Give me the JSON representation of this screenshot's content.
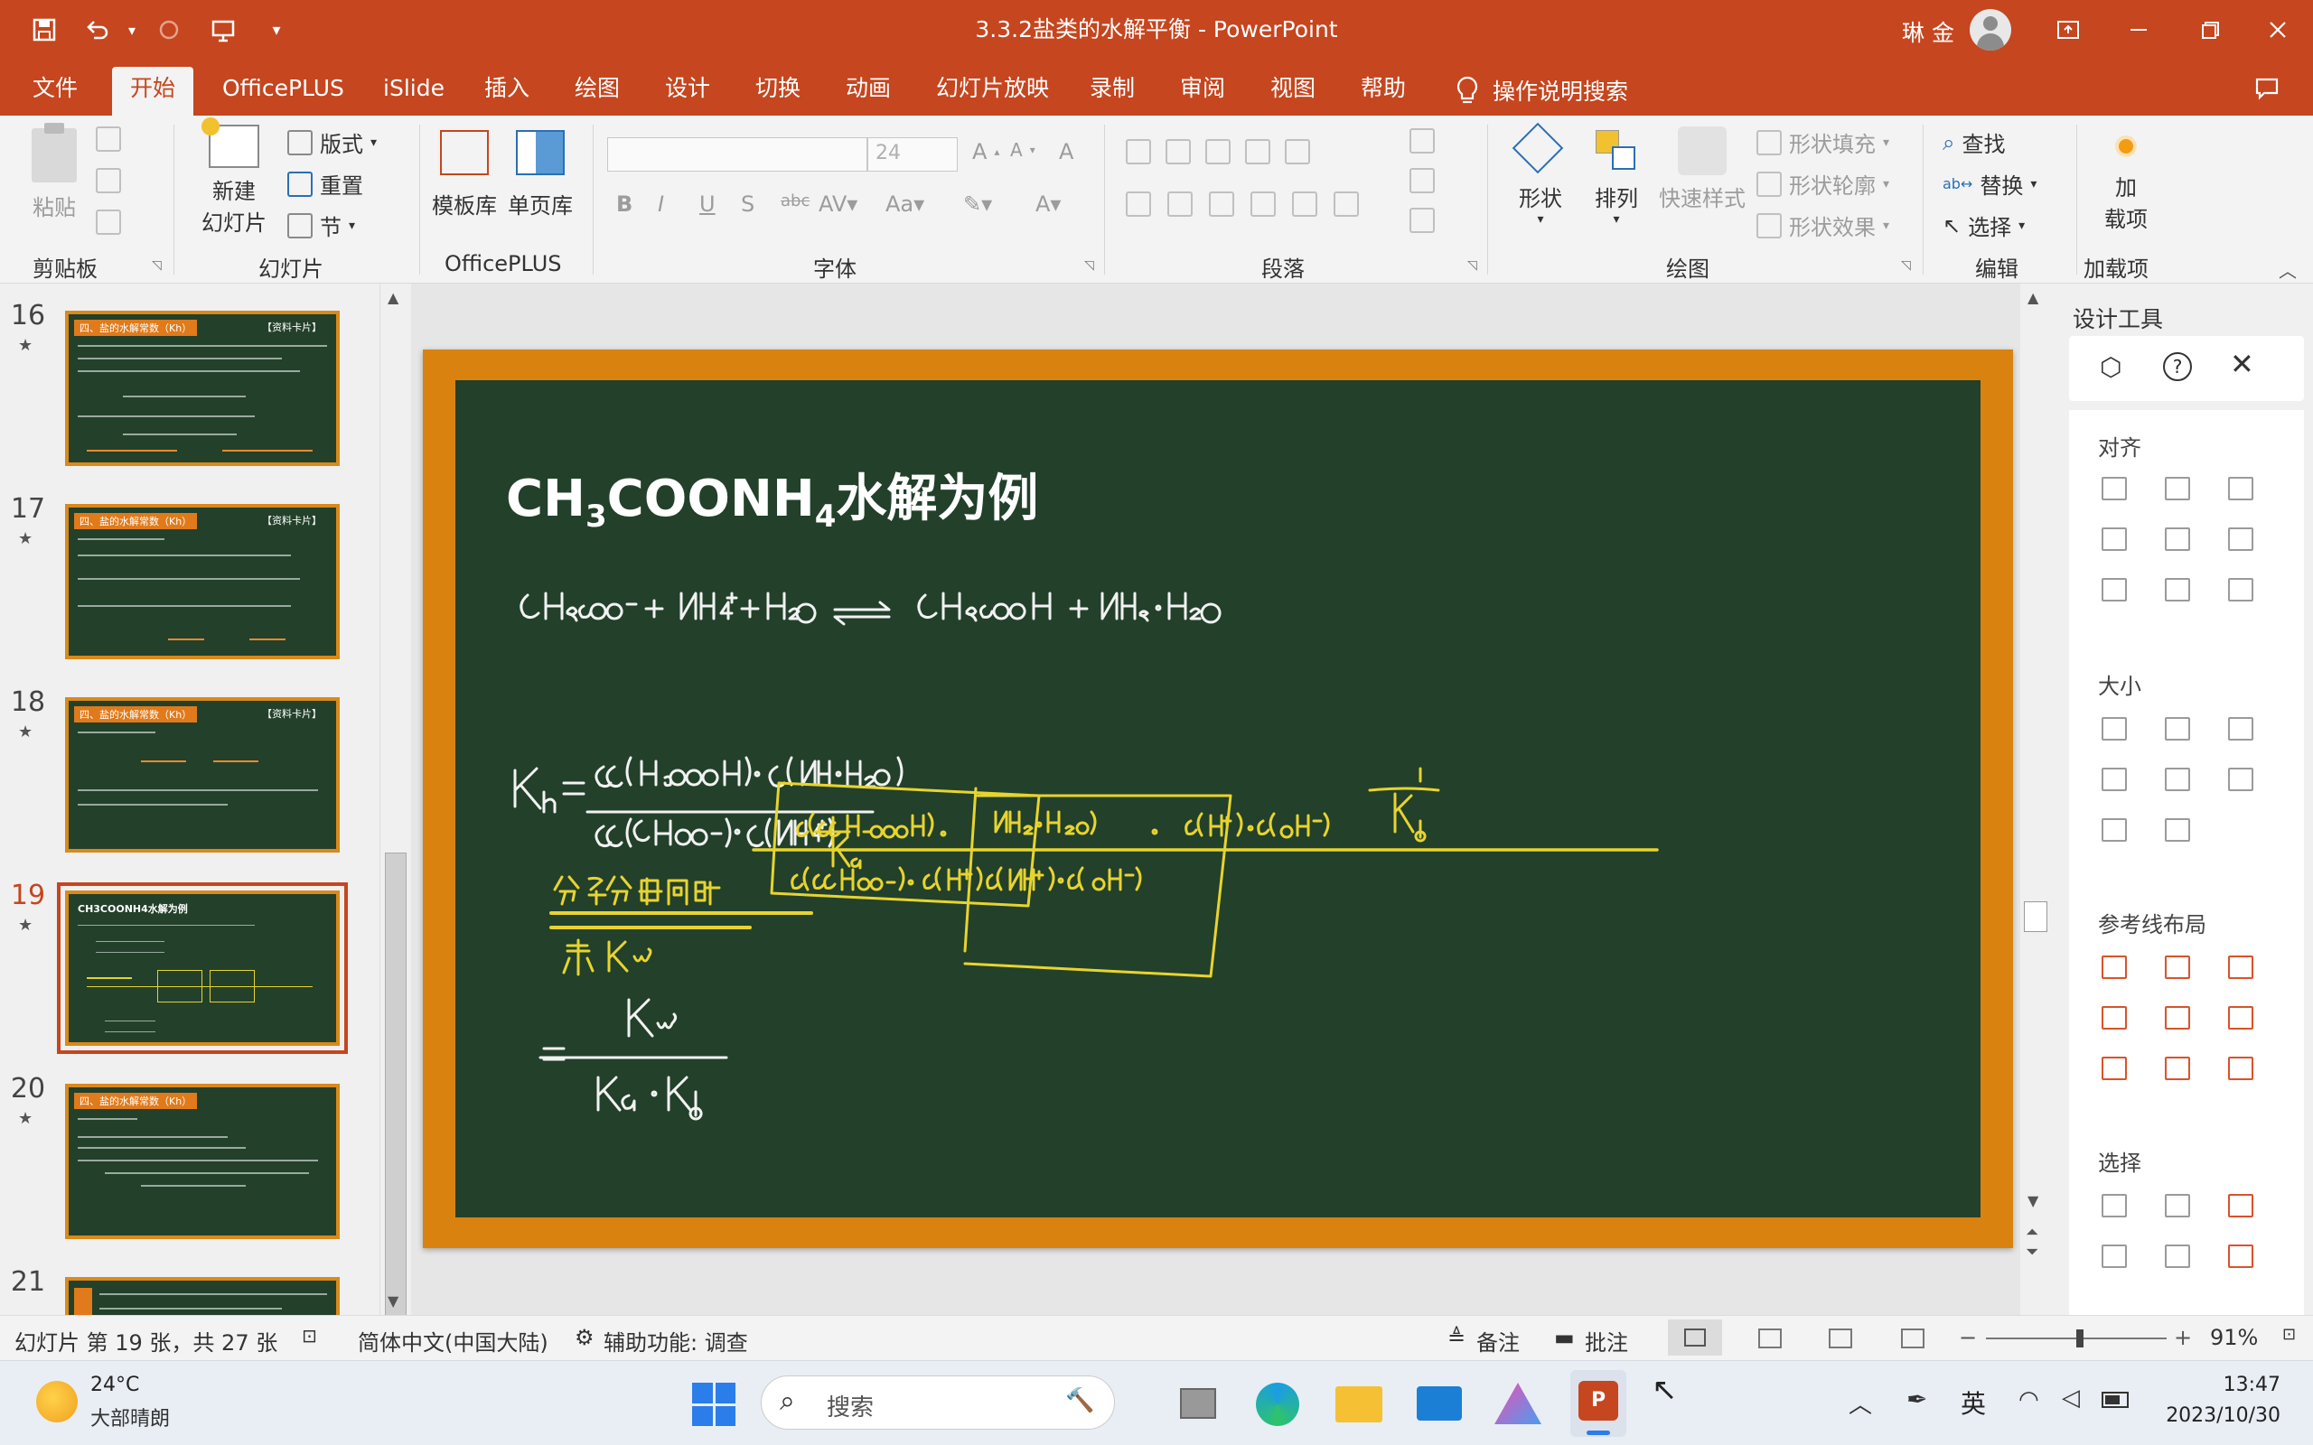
{
  "window": {
    "title": "3.3.2盐类的水解平衡  -  PowerPoint",
    "user": "琳 金",
    "accent": "#c5461f"
  },
  "tabs": [
    "文件",
    "开始",
    "OfficePLUS",
    "iSlide",
    "插入",
    "绘图",
    "设计",
    "切换",
    "动画",
    "幻灯片放映",
    "录制",
    "审阅",
    "视图",
    "帮助"
  ],
  "active_tab": "开始",
  "search_tell": "操作说明搜索",
  "ribbon": {
    "clipboard": {
      "paste": "粘贴",
      "label": "剪贴板"
    },
    "slides": {
      "new_slide": "新建\n幻灯片",
      "new_slide_a": "新建",
      "new_slide_b": "幻灯片",
      "layout": "版式",
      "reset": "重置",
      "section": "节",
      "label": "幻灯片"
    },
    "officeplus": {
      "template": "模板库",
      "single": "单页库",
      "label": "OfficePLUS"
    },
    "font": {
      "size": "24",
      "label": "字体"
    },
    "paragraph": {
      "label": "段落"
    },
    "drawing": {
      "shapes": "形状",
      "arrange": "排列",
      "quick": "快速样式",
      "fill": "形状填充",
      "outline": "形状轮廓",
      "effect": "形状效果",
      "label": "绘图"
    },
    "editing": {
      "find": "查找",
      "replace": "替换",
      "select": "选择",
      "label": "编辑"
    },
    "addins": {
      "load": "加\n载项",
      "load_a": "加",
      "load_b": "载项",
      "label": "加载项"
    }
  },
  "thumbnails": [
    {
      "num": "16",
      "tag": "四、盐的水解常数（Kh）",
      "card": "【资料卡片】"
    },
    {
      "num": "17",
      "tag": "四、盐的水解常数（Kh）",
      "card": "【资料卡片】"
    },
    {
      "num": "18",
      "tag": "四、盐的水解常数（Kh）",
      "card": "【资料卡片】"
    },
    {
      "num": "19",
      "tag": "CH3COONH4水解为例",
      "card": ""
    },
    {
      "num": "20",
      "tag": "四、盐的水解常数（Kh）",
      "card": ""
    },
    {
      "num": "21",
      "tag": "",
      "card": ""
    }
  ],
  "active_slide": "19",
  "slide": {
    "title_a": "CH",
    "title_sub1": "3",
    "title_b": "COONH",
    "title_sub2": "4",
    "title_c": "水解为例"
  },
  "design_pane": {
    "title": "设计工具",
    "sections": [
      "对齐",
      "大小",
      "参考线布局",
      "选择"
    ]
  },
  "status": {
    "slide_info": "幻灯片 第 19 张，共 27 张",
    "language": "简体中文(中国大陆)",
    "accessibility": "辅助功能: 调查",
    "notes": "备注",
    "comments": "批注",
    "zoom": "91%",
    "zoom_level": 0.52
  },
  "taskbar": {
    "weather_temp": "24°C",
    "weather_text": "大部晴朗",
    "search_placeholder": "搜索",
    "ime": "英",
    "time": "13:47",
    "date": "2023/10/30"
  }
}
